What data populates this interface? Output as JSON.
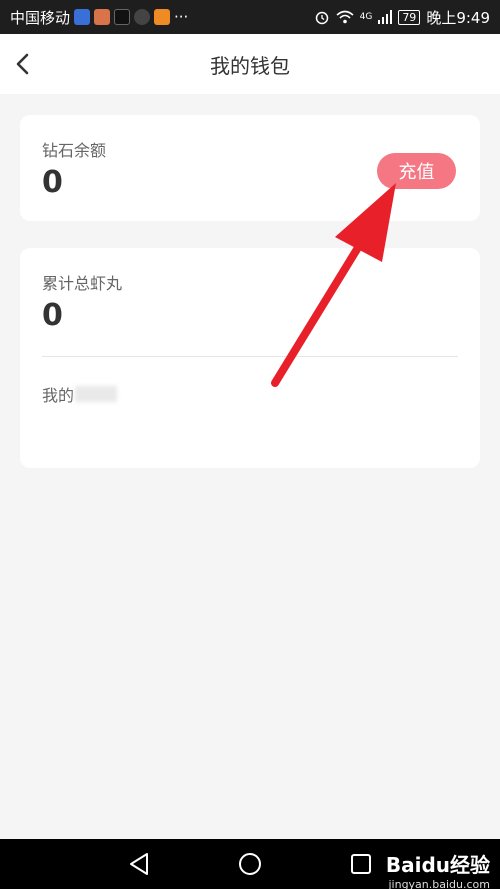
{
  "status_bar": {
    "carrier": "中国移动",
    "more": "···",
    "network": "4G",
    "battery": "79",
    "time": "晚上9:49"
  },
  "header": {
    "title": "我的钱包"
  },
  "diamond_card": {
    "label": "钻石余额",
    "value": "0",
    "recharge_label": "充值"
  },
  "shrimp_card": {
    "label": "累计总虾丸",
    "value": "0",
    "my_label": "我的"
  },
  "watermark": {
    "brand": "Baidu经验",
    "url": "jingyan.baidu.com"
  },
  "colors": {
    "accent": "#f47783",
    "annotation_arrow": "#e8202a"
  }
}
